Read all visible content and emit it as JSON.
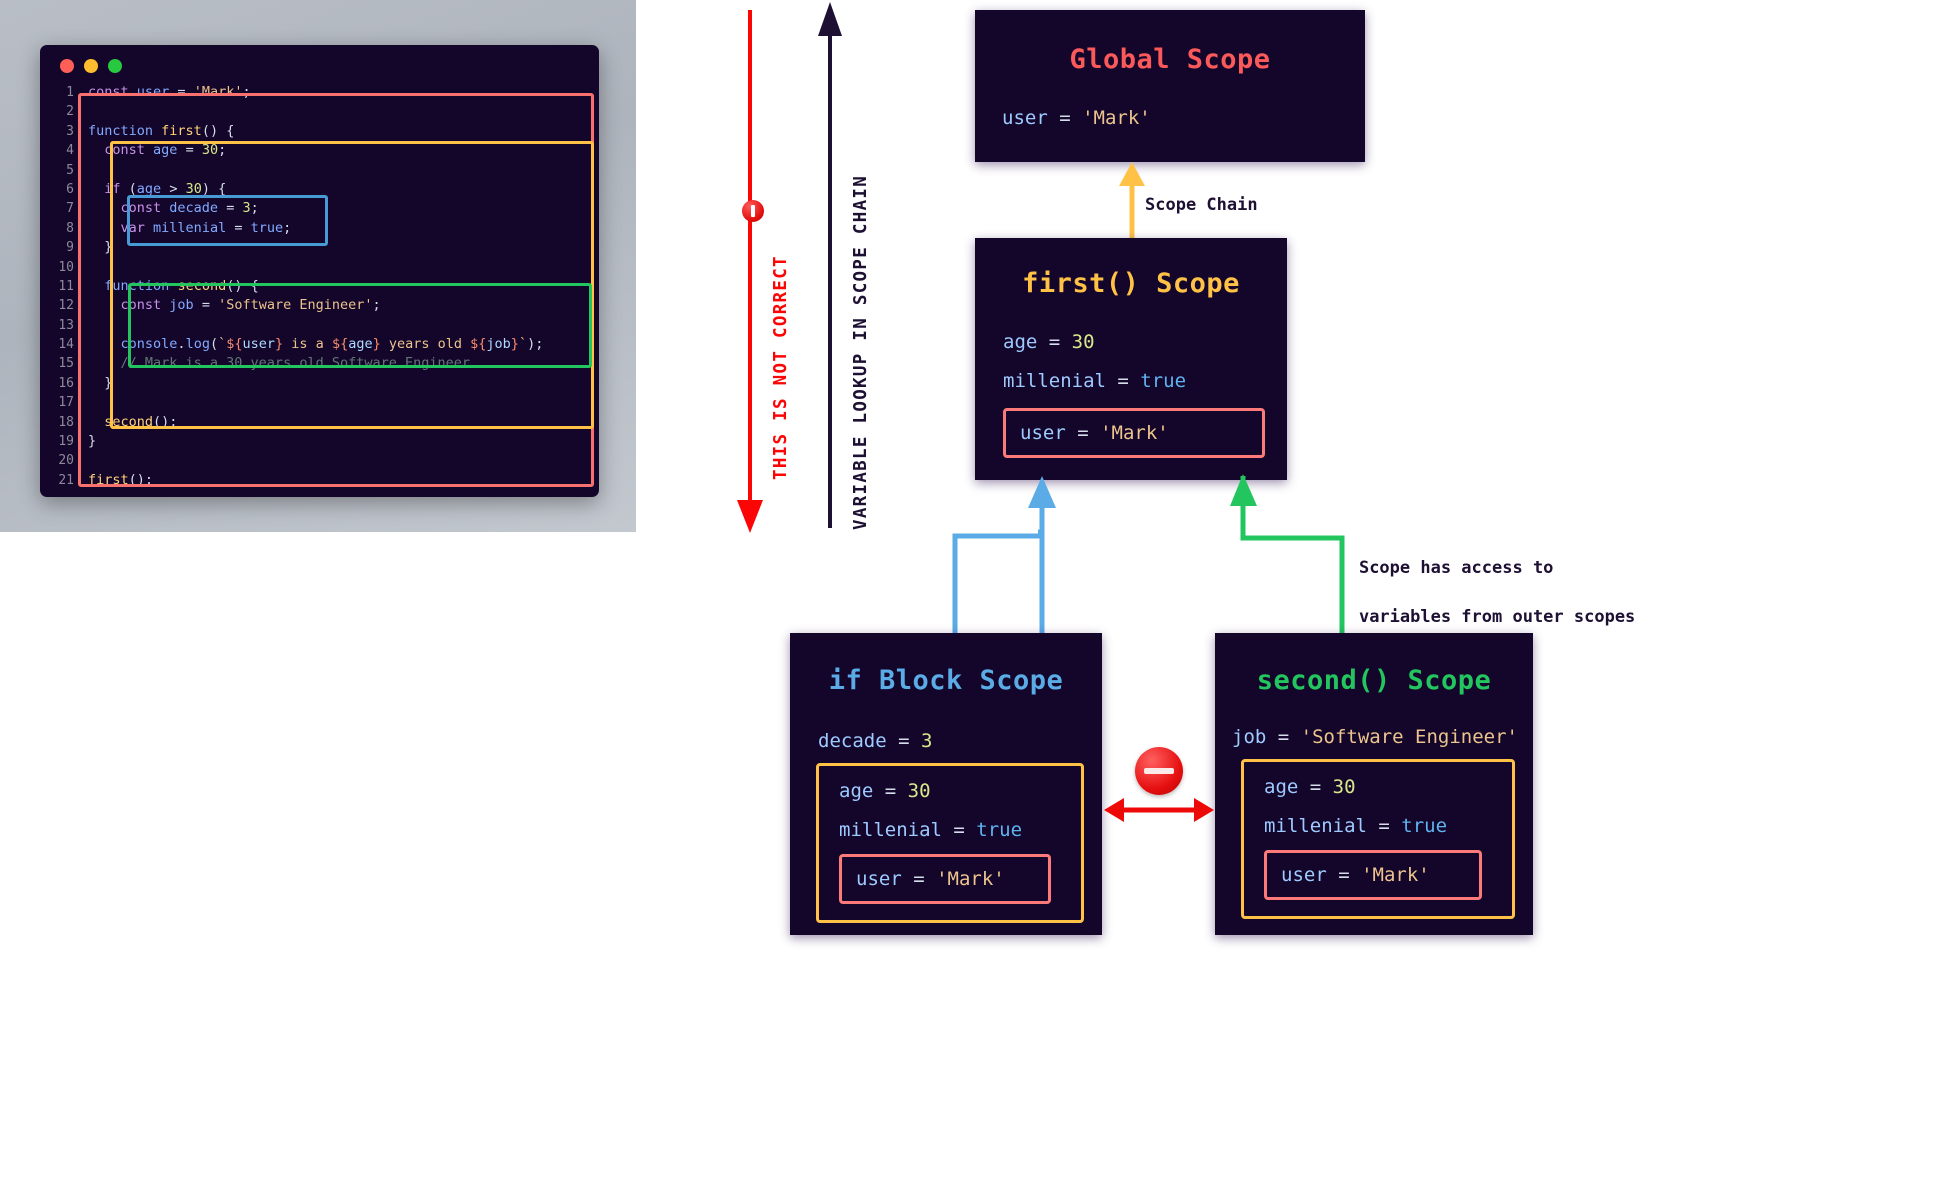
{
  "editor": {
    "window_dots": [
      "close-red",
      "minimize-amber",
      "maximize-green"
    ],
    "lines": [
      {
        "n": "1",
        "text": "const user = 'Mark';"
      },
      {
        "n": "2",
        "text": ""
      },
      {
        "n": "3",
        "text": "function first() {"
      },
      {
        "n": "4",
        "text": "  const age = 30;"
      },
      {
        "n": "5",
        "text": ""
      },
      {
        "n": "6",
        "text": "  if (age > 30) {"
      },
      {
        "n": "7",
        "text": "    const decade = 3;"
      },
      {
        "n": "8",
        "text": "    var millenial = true;"
      },
      {
        "n": "9",
        "text": "  }"
      },
      {
        "n": "10",
        "text": ""
      },
      {
        "n": "11",
        "text": "  function second() {"
      },
      {
        "n": "12",
        "text": "    const job = 'Software Engineer';"
      },
      {
        "n": "13",
        "text": ""
      },
      {
        "n": "14",
        "text": "    console.log(`${user} is a ${age} years old ${job}`);"
      },
      {
        "n": "15",
        "text": "    // Mark is a 30 years old Software Engineer"
      },
      {
        "n": "16",
        "text": "  }"
      },
      {
        "n": "17",
        "text": ""
      },
      {
        "n": "18",
        "text": "  second();"
      },
      {
        "n": "19",
        "text": "}"
      },
      {
        "n": "20",
        "text": ""
      },
      {
        "n": "21",
        "text": "first();"
      }
    ],
    "highlight_boxes": [
      {
        "name": "global-scope-box",
        "color": "#f9716f"
      },
      {
        "name": "first-scope-box",
        "color": "#ffc247"
      },
      {
        "name": "if-block-scope-box",
        "color": "#489ad4"
      },
      {
        "name": "second-scope-box",
        "color": "#22c55e"
      }
    ]
  },
  "diagram": {
    "left_label": "THIS IS NOT CORRECT",
    "left_label_color": "#fb0505",
    "arrow_label": "VARIABLE LOOKUP IN SCOPE CHAIN",
    "arrow_label_color": "#1d1033",
    "scope_chain_label": "Scope Chain",
    "outer_access_label": "Scope has access to\nvariables from outer scopes",
    "outer_access_line1": "Scope has access to",
    "outer_access_line2": "variables from outer scopes",
    "icons": {
      "not_correct": "no-entry-icon",
      "no_access": "no-entry-icon"
    },
    "colors": {
      "global": "#fc5a5a",
      "first": "#ffc247",
      "if": "#5aabe6",
      "second": "#22c55e",
      "red_box": "#fc7a79",
      "panel_bg": "#14052a"
    },
    "boxes": [
      {
        "id": "global",
        "title": "Global Scope",
        "title_color": "#fc5a5a",
        "vars": [
          {
            "name": "user",
            "eq": " = ",
            "value": "'Mark'",
            "kind": "str"
          }
        ]
      },
      {
        "id": "first",
        "title": "first() Scope",
        "title_color": "#ffc247",
        "vars": [
          {
            "name": "age",
            "eq": " = ",
            "value": "30",
            "kind": "num"
          },
          {
            "name": "millenial",
            "eq": " = ",
            "value": "true",
            "kind": "bool"
          }
        ],
        "inherited": [
          {
            "name": "user",
            "eq": " = ",
            "value": "'Mark'",
            "kind": "str"
          }
        ]
      },
      {
        "id": "ifblock",
        "title": "if Block Scope",
        "title_color": "#5aabe6",
        "vars": [
          {
            "name": "decade",
            "eq": " = ",
            "value": "3",
            "kind": "num"
          }
        ],
        "from_first": [
          {
            "name": "age",
            "eq": " = ",
            "value": "30",
            "kind": "num"
          },
          {
            "name": "millenial",
            "eq": " = ",
            "value": "true",
            "kind": "bool"
          }
        ],
        "inherited": [
          {
            "name": "user",
            "eq": " = ",
            "value": "'Mark'",
            "kind": "str"
          }
        ]
      },
      {
        "id": "second",
        "title": "second() Scope",
        "title_color": "#22c55e",
        "vars": [
          {
            "name": "job",
            "eq": " = ",
            "value": "'Software Engineer'",
            "kind": "str"
          }
        ],
        "from_first": [
          {
            "name": "age",
            "eq": " = ",
            "value": "30",
            "kind": "num"
          },
          {
            "name": "millenial",
            "eq": " = ",
            "value": "true",
            "kind": "bool"
          }
        ],
        "inherited": [
          {
            "name": "user",
            "eq": " = ",
            "value": "'Mark'",
            "kind": "str"
          }
        ]
      }
    ]
  }
}
